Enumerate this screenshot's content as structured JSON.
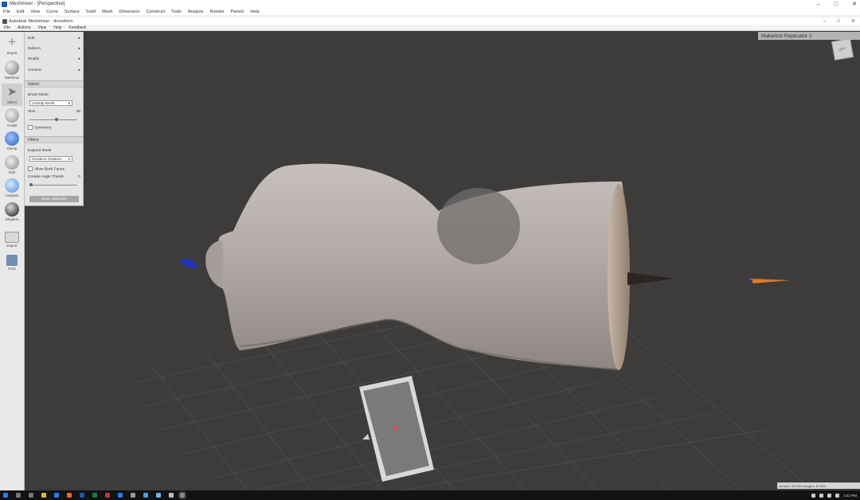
{
  "window": {
    "title": "Meshmixer - [Perspective]",
    "controls": [
      "–",
      "□",
      "✕"
    ]
  },
  "menubar": [
    "File",
    "Edit",
    "View",
    "Curve",
    "Surface",
    "Solid",
    "Mesh",
    "Dimension",
    "Construct",
    "Tools",
    "Analyze",
    "Render",
    "Panels",
    "Help"
  ],
  "document": {
    "title": "Autodesk Meshmixer - dressform",
    "controls": [
      "–",
      "□",
      "✕"
    ]
  },
  "app_menu": [
    "File",
    "Actions",
    "View",
    "Help",
    "Feedback"
  ],
  "toolbar": [
    {
      "label": "Import",
      "icon": "plus-icon",
      "active": false
    },
    {
      "label": "Meshmix",
      "icon": "sphere-icon",
      "active": false
    },
    {
      "label": "Select",
      "icon": "arrow-cursor-icon",
      "active": true
    },
    {
      "label": "Sculpt",
      "icon": "brush-icon",
      "active": false
    },
    {
      "label": "Stamp",
      "icon": "stamp-icon",
      "active": false
    },
    {
      "label": "Edit",
      "icon": "edit-icon",
      "active": false
    },
    {
      "label": "Analysis",
      "icon": "globe-icon",
      "active": false
    },
    {
      "label": "Shaders",
      "icon": "shader-ball-icon",
      "active": false
    },
    {
      "label": "Export",
      "icon": "folder-icon",
      "active": false
    },
    {
      "label": "Print",
      "icon": "printer-icon",
      "active": false
    }
  ],
  "panel": {
    "menu_items": [
      "Edit",
      "Deform",
      "Modify",
      "Convert"
    ],
    "select_header": "Select",
    "brush_mode_label": "Brush Mode",
    "brush_mode_value": "Unwrap Brush",
    "size_label": "Size",
    "size_value": 35,
    "symmetry_label": "Symmetry",
    "filters_header": "Filters",
    "expand_mode_label": "Expand Mode",
    "expand_mode_value": "Geodesic Distance",
    "allow_back_faces_label": "Allow Back Faces",
    "crease_angle_label": "Crease Angle Thresh",
    "crease_angle_value": 0,
    "clear_button": "Clear Selection"
  },
  "viewport": {
    "printer_name": "Makerbot Replicator 2",
    "view_cube_label": "LEFT",
    "status_text": "vertices: 28,934 triangles: 57,864"
  },
  "taskbar": {
    "clock": "3:42 PM"
  },
  "colors": {
    "viewport_bg": "#3d3c3b",
    "grid_line": "#5a5958",
    "model": "#b3aaa7",
    "selection": "#6e6c6b",
    "build_plate": "#7a7a7a",
    "axis_orange": "#e07a1c",
    "axis_blue": "#2233bb"
  }
}
